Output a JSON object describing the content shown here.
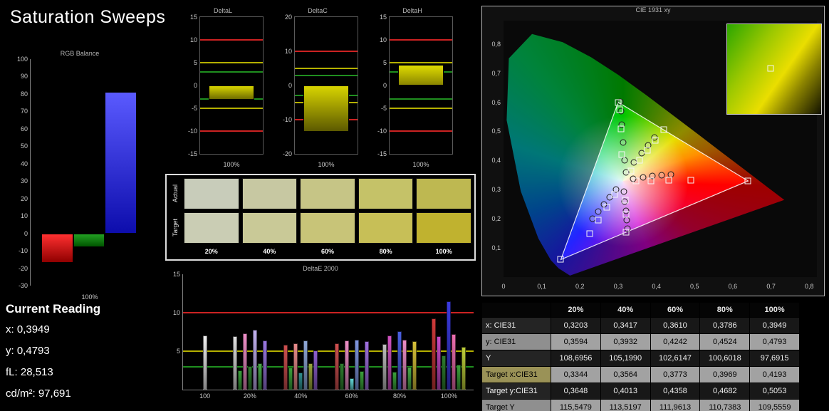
{
  "page": {
    "title": "Saturation Sweeps"
  },
  "current_reading": {
    "title": "Current Reading",
    "items": [
      {
        "label": "x:",
        "value": "0,3949"
      },
      {
        "label": "y:",
        "value": "0,4793"
      },
      {
        "label": "fL:",
        "value": "28,513"
      },
      {
        "label": "cd/m²:",
        "value": "97,691"
      }
    ]
  },
  "swatch_table": {
    "row_labels": [
      "Actual",
      "Target"
    ],
    "columns": [
      "20%",
      "40%",
      "60%",
      "80%",
      "100%"
    ],
    "actual_colors": [
      "#c8ccba",
      "#c7c8a2",
      "#c6c586",
      "#c5c268",
      "#beb851"
    ],
    "target_colors": [
      "#cacdb4",
      "#c9c997",
      "#c8c478",
      "#c7bf57",
      "#c0b22f"
    ]
  },
  "chart_data": [
    {
      "id": "rgb_balance",
      "type": "bar",
      "title": "RGB Balance",
      "xlabel": "100%",
      "ylim": [
        -30,
        100
      ],
      "yticks": [
        100,
        90,
        80,
        70,
        60,
        50,
        40,
        30,
        20,
        10,
        0,
        -10,
        -20,
        -30
      ],
      "categories": [
        "Red",
        "Green",
        "Blue"
      ],
      "values": [
        -17,
        -8,
        81
      ],
      "bar_gradients": [
        [
          "#ff3030",
          "#8f0000"
        ],
        [
          "#22a022",
          "#005500"
        ],
        [
          "#5a5aff",
          "#0d0dac"
        ]
      ]
    },
    {
      "id": "delta_l",
      "type": "bar",
      "title": "DeltaL",
      "xlabel": "100%",
      "ylim": [
        -15,
        15
      ],
      "yticks": [
        15,
        10,
        5,
        0,
        -5,
        -10,
        -15
      ],
      "categories": [
        "100%"
      ],
      "values": [
        -3.2
      ],
      "bar_gradients": [
        [
          "#d8d400",
          "#6f6b00"
        ]
      ],
      "reference_lines": [
        {
          "y": 10,
          "color": "#cc2222"
        },
        {
          "y": 5,
          "color": "#b4b000"
        },
        {
          "y": 3,
          "color": "#1f8f1f"
        },
        {
          "y": -3,
          "color": "#1f8f1f"
        },
        {
          "y": -5,
          "color": "#b4b000"
        },
        {
          "y": -10,
          "color": "#cc2222"
        }
      ]
    },
    {
      "id": "delta_c",
      "type": "bar",
      "title": "DeltaC",
      "xlabel": "100%",
      "ylim": [
        -20,
        20
      ],
      "yticks": [
        20,
        10,
        0,
        -10,
        -20
      ],
      "categories": [
        "100%"
      ],
      "values": [
        -13.5
      ],
      "bar_gradients": [
        [
          "#d8d400",
          "#5c5900"
        ]
      ],
      "reference_lines": [
        {
          "y": 10,
          "color": "#cc2222"
        },
        {
          "y": 5,
          "color": "#b4b000"
        },
        {
          "y": 3,
          "color": "#1f8f1f"
        },
        {
          "y": -3,
          "color": "#1f8f1f"
        },
        {
          "y": -5,
          "color": "#b4b000"
        },
        {
          "y": -10,
          "color": "#cc2222"
        }
      ]
    },
    {
      "id": "delta_h",
      "type": "bar",
      "title": "DeltaH",
      "xlabel": "100%",
      "ylim": [
        -15,
        15
      ],
      "yticks": [
        15,
        10,
        5,
        0,
        -5,
        -10,
        -15
      ],
      "categories": [
        "100%"
      ],
      "values": [
        4.6
      ],
      "bar_gradients": [
        [
          "#e0dc00",
          "#8a8600"
        ]
      ],
      "reference_lines": [
        {
          "y": 10,
          "color": "#cc2222"
        },
        {
          "y": 5,
          "color": "#b4b000"
        },
        {
          "y": 3,
          "color": "#1f8f1f"
        },
        {
          "y": -3,
          "color": "#1f8f1f"
        },
        {
          "y": -5,
          "color": "#b4b000"
        },
        {
          "y": -10,
          "color": "#cc2222"
        }
      ]
    },
    {
      "id": "delta_e",
      "type": "bar",
      "title": "DeltaE 2000",
      "ylim": [
        0,
        15
      ],
      "yticks": [
        15,
        10,
        5
      ],
      "reference_lines": [
        {
          "y": 10,
          "color": "#cc2222"
        },
        {
          "y": 5,
          "color": "#b4b000"
        },
        {
          "y": 3,
          "color": "#1f8f1f"
        }
      ],
      "groups": [
        {
          "label": "100",
          "bars": [
            {
              "color": "#f0f0f0",
              "value": 7.0
            }
          ]
        },
        {
          "label": "20%",
          "bars": [
            {
              "color": "#e0e0e0",
              "value": 6.9
            },
            {
              "color": "#3aa03a",
              "value": 2.5
            },
            {
              "color": "#ef8fc8",
              "value": 7.3
            },
            {
              "color": "#2e7d2e",
              "value": 3.1
            },
            {
              "color": "#c2b1f0",
              "value": 7.8
            },
            {
              "color": "#49a949",
              "value": 3.4
            },
            {
              "color": "#9a77e0",
              "value": 6.4
            }
          ]
        },
        {
          "label": "40%",
          "bars": [
            {
              "color": "#d05050",
              "value": 5.8
            },
            {
              "color": "#3aa03a",
              "value": 2.9
            },
            {
              "color": "#e98c8c",
              "value": 6.0
            },
            {
              "color": "#2f8f8f",
              "value": 2.2
            },
            {
              "color": "#8fa8d8",
              "value": 6.4
            },
            {
              "color": "#9aa53a",
              "value": 3.4
            },
            {
              "color": "#8f5fd0",
              "value": 5.1
            }
          ]
        },
        {
          "label": "60%",
          "bars": [
            {
              "color": "#d05050",
              "value": 6.0
            },
            {
              "color": "#2e7d2e",
              "value": 3.4
            },
            {
              "color": "#ef8fc8",
              "value": 6.4
            },
            {
              "color": "#62d8d8",
              "value": 1.5
            },
            {
              "color": "#7f96e0",
              "value": 6.5
            },
            {
              "color": "#3aa03a",
              "value": 2.4
            },
            {
              "color": "#a070e0",
              "value": 6.3
            }
          ]
        },
        {
          "label": "80%",
          "bars": [
            {
              "color": "#bfbfbf",
              "value": 5.9
            },
            {
              "color": "#d052c0",
              "value": 7.0
            },
            {
              "color": "#3aa03a",
              "value": 2.3
            },
            {
              "color": "#4a5fe0",
              "value": 7.6
            },
            {
              "color": "#ef8fc8",
              "value": 6.5
            },
            {
              "color": "#49a949",
              "value": 3.0
            },
            {
              "color": "#d8c23a",
              "value": 6.3
            }
          ]
        },
        {
          "label": "100%",
          "bars": [
            {
              "color": "#d03a3a",
              "value": 9.3
            },
            {
              "color": "#c84ac8",
              "value": 6.9
            },
            {
              "color": "#2e7d2e",
              "value": 4.4
            },
            {
              "color": "#3a3ae0",
              "value": 11.5
            },
            {
              "color": "#ee6fb0",
              "value": 7.2
            },
            {
              "color": "#3aa03a",
              "value": 3.2
            },
            {
              "color": "#bfd03a",
              "value": 5.6
            }
          ]
        }
      ]
    },
    {
      "id": "cie",
      "type": "scatter",
      "title": "CIE 1931 xy",
      "xlim": [
        0,
        0.82
      ],
      "ylim": [
        0,
        0.88
      ],
      "xticks": [
        "0",
        "0,1",
        "0,2",
        "0,3",
        "0,4",
        "0,5",
        "0,6",
        "0,7",
        "0,8"
      ],
      "yticks": [
        "0,1",
        "0,2",
        "0,3",
        "0,4",
        "0,5",
        "0,6",
        "0,7",
        "0,8"
      ],
      "gamut_triangle": [
        [
          0.64,
          0.33
        ],
        [
          0.3,
          0.6
        ],
        [
          0.15,
          0.06
        ]
      ],
      "inset": {
        "marker": [
          0.46,
          0.49
        ]
      },
      "series": [
        {
          "name": "measured",
          "marker": "circle",
          "points": [
            [
              0.3203,
              0.3594
            ],
            [
              0.3417,
              0.3932
            ],
            [
              0.361,
              0.4242
            ],
            [
              0.3786,
              0.4524
            ],
            [
              0.3949,
              0.4793
            ],
            [
              0.316,
              0.4005
            ],
            [
              0.3128,
              0.4618
            ],
            [
              0.3099,
              0.5226
            ],
            [
              0.3072,
              0.5706
            ],
            [
              0.3049,
              0.6009
            ],
            [
              0.3398,
              0.3372
            ],
            [
              0.3644,
              0.3419
            ],
            [
              0.3889,
              0.3459
            ],
            [
              0.4132,
              0.3494
            ],
            [
              0.4373,
              0.3524
            ],
            [
              0.2952,
              0.3004
            ],
            [
              0.2786,
              0.2738
            ],
            [
              0.2627,
              0.2482
            ],
            [
              0.2475,
              0.2238
            ],
            [
              0.2331,
              0.2006
            ],
            [
              0.3151,
              0.2931
            ],
            [
              0.3176,
              0.2597
            ],
            [
              0.3201,
              0.2274
            ],
            [
              0.3226,
              0.1961
            ],
            [
              0.3251,
              0.1659
            ]
          ]
        },
        {
          "name": "target",
          "marker": "square",
          "points": [
            [
              0.3344,
              0.3648
            ],
            [
              0.3564,
              0.4013
            ],
            [
              0.3773,
              0.4358
            ],
            [
              0.3969,
              0.4682
            ],
            [
              0.4193,
              0.5053
            ],
            [
              0.346,
              0.33
            ],
            [
              0.386,
              0.331
            ],
            [
              0.433,
              0.332
            ],
            [
              0.49,
              0.332
            ],
            [
              0.64,
              0.33
            ],
            [
              0.3095,
              0.42
            ],
            [
              0.3067,
              0.508
            ],
            [
              0.304,
              0.575
            ],
            [
              0.3,
              0.6
            ],
            [
              0.2908,
              0.2841
            ],
            [
              0.2697,
              0.2404
            ],
            [
              0.248,
              0.1956
            ],
            [
              0.225,
              0.148
            ],
            [
              0.15,
              0.06
            ],
            [
              0.319,
              0.265
            ],
            [
              0.32,
              0.215
            ],
            [
              0.3209,
              0.1542
            ]
          ]
        }
      ]
    },
    {
      "id": "saturation_table",
      "type": "table",
      "columns": [
        "",
        "20%",
        "40%",
        "60%",
        "80%",
        "100%"
      ],
      "rows": [
        {
          "label": "x: CIE31",
          "values": [
            "0,3203",
            "0,3417",
            "0,3610",
            "0,3786",
            "0,3949"
          ]
        },
        {
          "label": "y: CIE31",
          "values": [
            "0,3594",
            "0,3932",
            "0,4242",
            "0,4524",
            "0,4793"
          ]
        },
        {
          "label": "Y",
          "values": [
            "108,6956",
            "105,1990",
            "102,6147",
            "100,6018",
            "97,6915"
          ]
        },
        {
          "label": "Target x:CIE31",
          "values": [
            "0,3344",
            "0,3564",
            "0,3773",
            "0,3969",
            "0,4193"
          ]
        },
        {
          "label": "Target y:CIE31",
          "values": [
            "0,3648",
            "0,4013",
            "0,4358",
            "0,4682",
            "0,5053"
          ]
        },
        {
          "label": "Target Y",
          "values": [
            "115,5479",
            "113,5197",
            "111,9613",
            "110,7383",
            "109,5559"
          ]
        }
      ]
    }
  ]
}
